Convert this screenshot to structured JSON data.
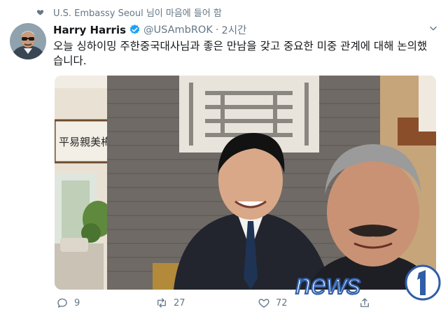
{
  "context": {
    "text": "U.S. Embassy Seoul 님이 마음에 들어 함"
  },
  "tweet": {
    "author_name": "Harry Harris",
    "handle": "@USAmbROK",
    "separator": "·",
    "time": "2시간",
    "text": "오늘 싱하이밍 주한중국대사님과 좋은 만남을 갖고 중요한 미중 관계에 대해 논의했습니다.",
    "photo_sign_text": "平易親美樺"
  },
  "actions": {
    "reply_count": "9",
    "retweet_count": "27",
    "like_count": "72"
  },
  "watermark": {
    "brand": "news1"
  },
  "colors": {
    "secondary_text": "#657786",
    "verified_blue": "#1da1f2",
    "watermark_blue": "#2f5da8"
  }
}
